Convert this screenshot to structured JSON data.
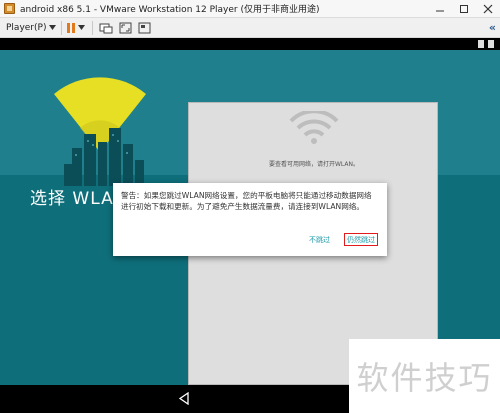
{
  "window": {
    "title": "android x86 5.1 - VMware Workstation 12 Player (仅用于非商业用途)",
    "minimize_icon": "minimize-icon",
    "maximize_icon": "maximize-icon",
    "close_icon": "close-icon"
  },
  "toolbar": {
    "player_menu_label": "Player(P)",
    "pause_icon": "pause-icon",
    "send_keys_icon": "ctrl-alt-del-icon",
    "fullscreen_icon": "fullscreen-icon",
    "unity_icon": "unity-icon",
    "collapse_icon": "double-chevron-icon"
  },
  "android": {
    "left_heading": "选择 WLAN",
    "card_message": "要查看可用网络，请打开WLAN。",
    "dialog": {
      "message": "警告：如果您跳过WLAN网络设置，您的平板电脑将只能通过移动数据网络进行初始下载和更新。为了避免产生数据流量费，请连接到WLAN网络。",
      "skip_label": "不跳过",
      "still_skip_label": "仍然跳过"
    },
    "nav_back_icon": "back-triangle-icon"
  },
  "watermark": {
    "text": "软件技巧"
  },
  "colors": {
    "screen_teal": "#1f7f8c",
    "accent_teal": "#1a9aa8",
    "highlight_red": "#e01c1c",
    "wifi_yellow": "#e6df23"
  }
}
